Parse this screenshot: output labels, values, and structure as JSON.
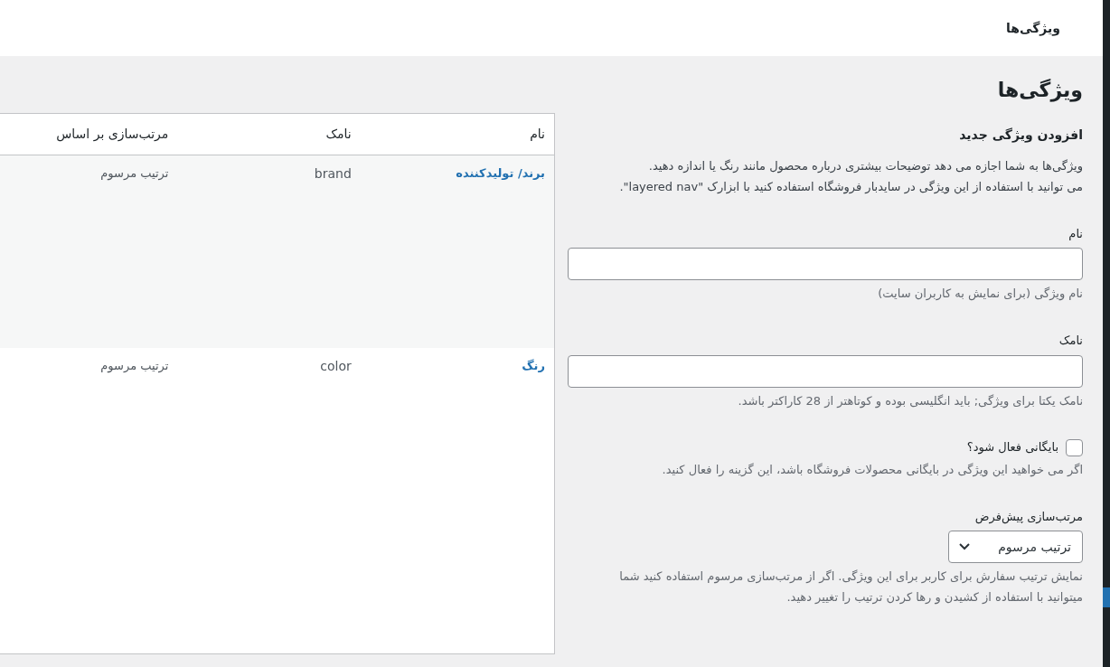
{
  "header": {
    "title": "ویژگی‌ها"
  },
  "page_title": "ویژگی‌ها",
  "table": {
    "columns": [
      "نام",
      "نامک",
      "مرتب‌سازی بر اساس"
    ],
    "rows": [
      {
        "name": "برند/ تولیدکننده",
        "slug": "brand",
        "order": "ترتیب مرسوم"
      },
      {
        "name": "رنگ",
        "slug": "color",
        "order": "ترتیب مرسوم"
      }
    ]
  },
  "form": {
    "heading": "افزودن ویژگی جدید",
    "intro": [
      "ویژگی‌ها به شما اجازه می دهد توضیحات بیشتری درباره محصول مانند رنگ یا اندازه دهید.",
      "می توانید با استفاده از این ویژگی در سایدبار فروشگاه استفاده کنید با ابزارک \"layered nav\"."
    ],
    "fields": [
      {
        "kind": "text",
        "label": "نام",
        "help": "نام ویژگی (برای نمایش به کاربران سایت)"
      },
      {
        "kind": "text",
        "label": "نامک",
        "help": "نامک یکتا برای ویژگی; باید انگلیسی بوده و کوتاهتر از 28 کاراکتر باشد."
      },
      {
        "kind": "checkbox",
        "label": "بایگانی فعال شود؟",
        "checked": false,
        "help": "اگر می خواهید این ویژگی در بایگانی محصولات فروشگاه باشد، این گزینه را فعال کنید."
      },
      {
        "kind": "select",
        "label": "مرتب‌سازی پیش‌فرض",
        "value": "ترتیب مرسوم",
        "help": "نمایش ترتیب سفارش برای کاربر برای این ویژگی. اگر از مرتب‌سازی مرسوم استفاده کنید شما میتوانید با استفاده از کشیدن و رها کردن ترتیب را تغییر دهید."
      }
    ]
  }
}
